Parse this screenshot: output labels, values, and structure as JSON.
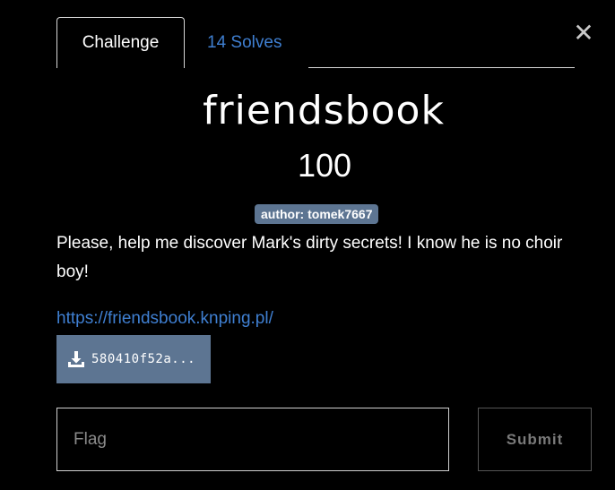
{
  "tabs": {
    "challenge_label": "Challenge",
    "solves_label": "14 Solves"
  },
  "close_icon": "close-icon",
  "challenge": {
    "name": "friendsbook",
    "points": "100",
    "author_badge": "author: tomek7667",
    "description": "Please, help me discover Mark's dirty secrets! I know he is no choir boy!",
    "link_text": "https://friendsbook.knping.pl/"
  },
  "download": {
    "icon": "download-icon",
    "label": "580410f52a..."
  },
  "form": {
    "flag_placeholder": "Flag",
    "flag_value": "",
    "submit_label": "Submit"
  },
  "colors": {
    "background": "#000000",
    "link": "#3f7fd1",
    "badge": "#5d7592",
    "download_button": "#5d7592"
  }
}
